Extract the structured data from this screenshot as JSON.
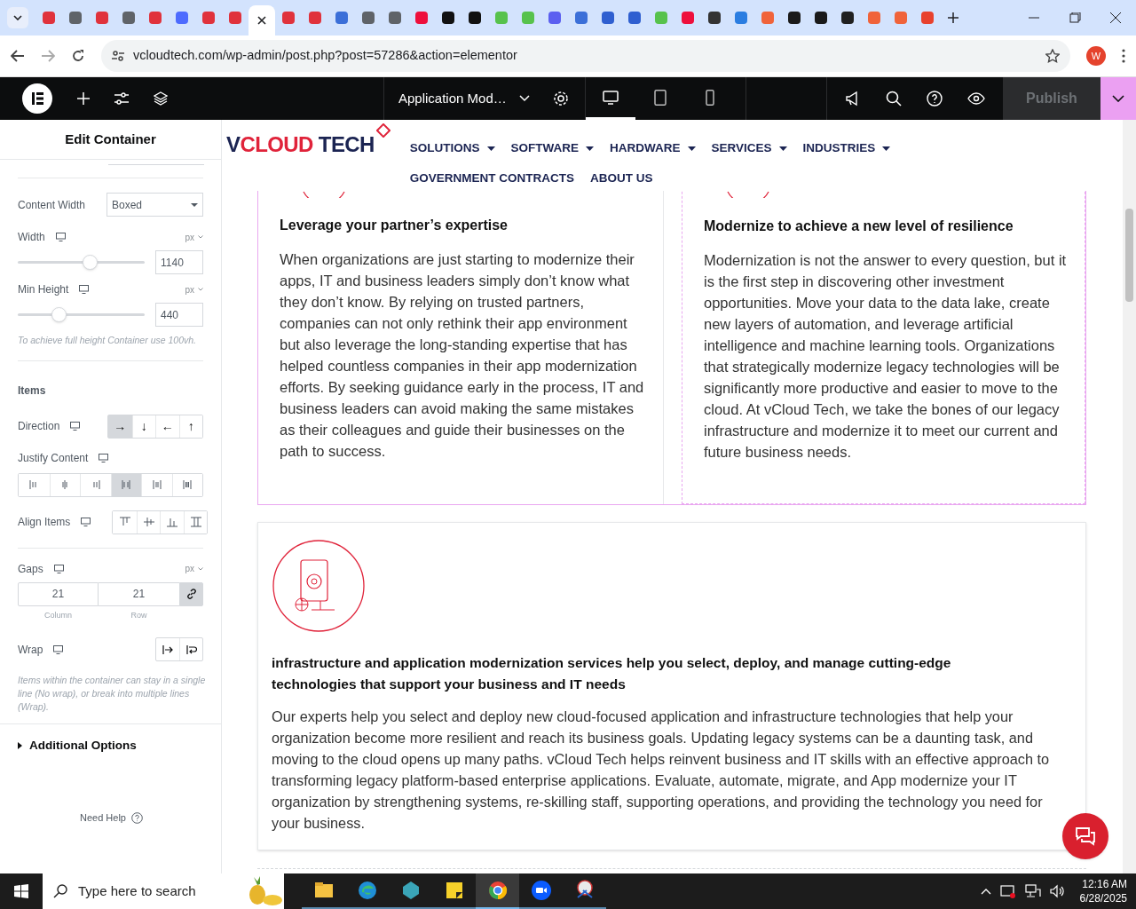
{
  "browser": {
    "tabs": [
      {
        "color": "#e0323c",
        "selected": false
      },
      {
        "color": "#5f6368",
        "selected": false
      },
      {
        "color": "#e0323c",
        "selected": false
      },
      {
        "color": "#5f6368",
        "selected": false
      },
      {
        "color": "#e0323c",
        "selected": false
      },
      {
        "color": "#4d6bfe",
        "selected": false
      },
      {
        "color": "#e0323c",
        "selected": false
      },
      {
        "color": "#e0323c",
        "selected": false
      },
      {
        "color": "#202124",
        "selected": true
      },
      {
        "color": "#e0323c",
        "selected": false
      },
      {
        "color": "#e0323c",
        "selected": false
      },
      {
        "color": "#3b6fd8",
        "selected": false
      },
      {
        "color": "#5f6368",
        "selected": false
      },
      {
        "color": "#5f6368",
        "selected": false
      },
      {
        "color": "#ee0f3c",
        "selected": false
      },
      {
        "color": "#111111",
        "selected": false
      },
      {
        "color": "#111111",
        "selected": false
      },
      {
        "color": "#57c24c",
        "selected": false
      },
      {
        "color": "#57c24c",
        "selected": false
      },
      {
        "color": "#5b5ff0",
        "selected": false
      },
      {
        "color": "#3b6fd8",
        "selected": false
      },
      {
        "color": "#2f5fd0",
        "selected": false
      },
      {
        "color": "#2f5fd0",
        "selected": false
      },
      {
        "color": "#57c24c",
        "selected": false
      },
      {
        "color": "#ee0f3c",
        "selected": false
      },
      {
        "color": "#333333",
        "selected": false
      },
      {
        "color": "#2a7de1",
        "selected": false
      },
      {
        "color": "#f0633a",
        "selected": false
      },
      {
        "color": "#1a1a1a",
        "selected": false
      },
      {
        "color": "#1a1a1a",
        "selected": false
      },
      {
        "color": "#202020",
        "selected": false
      },
      {
        "color": "#f0633a",
        "selected": false
      },
      {
        "color": "#f0633a",
        "selected": false
      },
      {
        "color": "#e8412d",
        "selected": false
      }
    ],
    "url": "vcloudtech.com/wp-admin/post.php?post=57286&action=elementor",
    "profile": "W"
  },
  "editor": {
    "document_title": "Application Mod…",
    "devices": [
      {
        "kind": "desktop",
        "selected": true
      },
      {
        "kind": "tablet",
        "selected": false
      },
      {
        "kind": "mobile",
        "selected": false
      }
    ],
    "publish": "Publish"
  },
  "panel": {
    "title": "Edit Container",
    "content_width": {
      "label": "Content Width",
      "value": "Boxed"
    },
    "width": {
      "label": "Width",
      "unit": "px",
      "level": 0.58,
      "value": "1140"
    },
    "min_height": {
      "label": "Min Height",
      "unit": "px",
      "level": 0.3,
      "value": "440",
      "hint": "To achieve full height Container use 100vh."
    },
    "items_heading": "Items",
    "direction": {
      "label": "Direction",
      "options": [
        {
          "glyph": "→",
          "selected": true
        },
        {
          "glyph": "↓",
          "selected": false
        },
        {
          "glyph": "←",
          "selected": false
        },
        {
          "glyph": "↑",
          "selected": false
        }
      ]
    },
    "justify": {
      "label": "Justify Content",
      "options": [
        {
          "kind": "start",
          "selected": false
        },
        {
          "kind": "center",
          "selected": false
        },
        {
          "kind": "end",
          "selected": false
        },
        {
          "kind": "between",
          "selected": true
        },
        {
          "kind": "around",
          "selected": false
        },
        {
          "kind": "evenly",
          "selected": false
        }
      ]
    },
    "align": {
      "label": "Align Items",
      "options": [
        {
          "kind": "top",
          "selected": false
        },
        {
          "kind": "middle",
          "selected": false
        },
        {
          "kind": "bottom",
          "selected": false
        },
        {
          "kind": "stretch",
          "selected": false
        }
      ]
    },
    "gaps": {
      "label": "Gaps",
      "unit": "px",
      "column": "21",
      "row": "21",
      "column_label": "Column",
      "row_label": "Row",
      "linked": true
    },
    "wrap": {
      "label": "Wrap",
      "hint": "Items within the container can stay in a single line (No wrap), or break into multiple lines (Wrap)."
    },
    "additional": "Additional Options",
    "help": "Need Help"
  },
  "site": {
    "logo": [
      {
        "text": "V",
        "color": "#1b2452"
      },
      {
        "text": "CLOUD",
        "color": "#e0233a"
      },
      {
        "text": " TECH",
        "color": "#1b2452"
      }
    ],
    "nav": [
      {
        "label": "SOLUTIONS",
        "dropdown": true
      },
      {
        "label": "SOFTWARE",
        "dropdown": true
      },
      {
        "label": "HARDWARE",
        "dropdown": true
      },
      {
        "label": "SERVICES",
        "dropdown": true
      },
      {
        "label": "INDUSTRIES",
        "dropdown": true
      },
      {
        "label": "GOVERNMENT CONTRACTS",
        "dropdown": false
      },
      {
        "label": "ABOUT US",
        "dropdown": false
      }
    ],
    "columns": [
      {
        "title": "Leverage your partner’s expertise",
        "body": "When organizations are just starting to modernize their apps, IT and business leaders simply don’t know what they don’t know. By relying on trusted partners, companies can not only rethink their app environment but also leverage the long-standing expertise that has helped countless companies in their app modernization efforts. By seeking guidance early in the process, IT and business leaders can avoid making the same mistakes as their colleagues and guide their businesses on the path to success."
      },
      {
        "title": "Modernize to achieve a new level of resilience",
        "body": "Modernization is not the answer to every question, but it is the first step in discovering other investment opportunities. Move your data to the data lake, create new layers of automation, and leverage artificial intelligence and machine learning tools. Organizations that strategically modernize legacy technologies will be significantly more productive and easier to move to the cloud. At vCloud Tech, we take the bones of our legacy infrastructure and modernize it to meet our current and future business needs."
      }
    ],
    "feature": {
      "title": "infrastructure and application modernization services help you select, deploy, and manage cutting-edge technologies that support your business and IT needs",
      "body": "Our experts help you select and deploy new cloud-focused application and infrastructure technologies that help your organization become more resilient and reach its business goals. Updating legacy systems can be a daunting task, and moving to the cloud opens up many paths. vCloud Tech helps reinvent business and IT skills with an effective approach to transforming legacy platform-based enterprise applications. Evaluate, automate, migrate, and App modernize your IT organization by strengthening systems, re-skilling staff, supporting operations, and providing the technology you need for your business."
    }
  },
  "taskbar": {
    "search": "Type here to search",
    "apps": [
      {
        "kind": "files",
        "selected": false
      },
      {
        "kind": "edge",
        "selected": false
      },
      {
        "kind": "gem",
        "selected": false
      },
      {
        "kind": "notes",
        "selected": false
      },
      {
        "kind": "chrome",
        "selected": true
      },
      {
        "kind": "zoom",
        "selected": false
      },
      {
        "kind": "snip",
        "selected": false
      }
    ],
    "time": "12:16 AM",
    "date": "6/28/2025"
  }
}
